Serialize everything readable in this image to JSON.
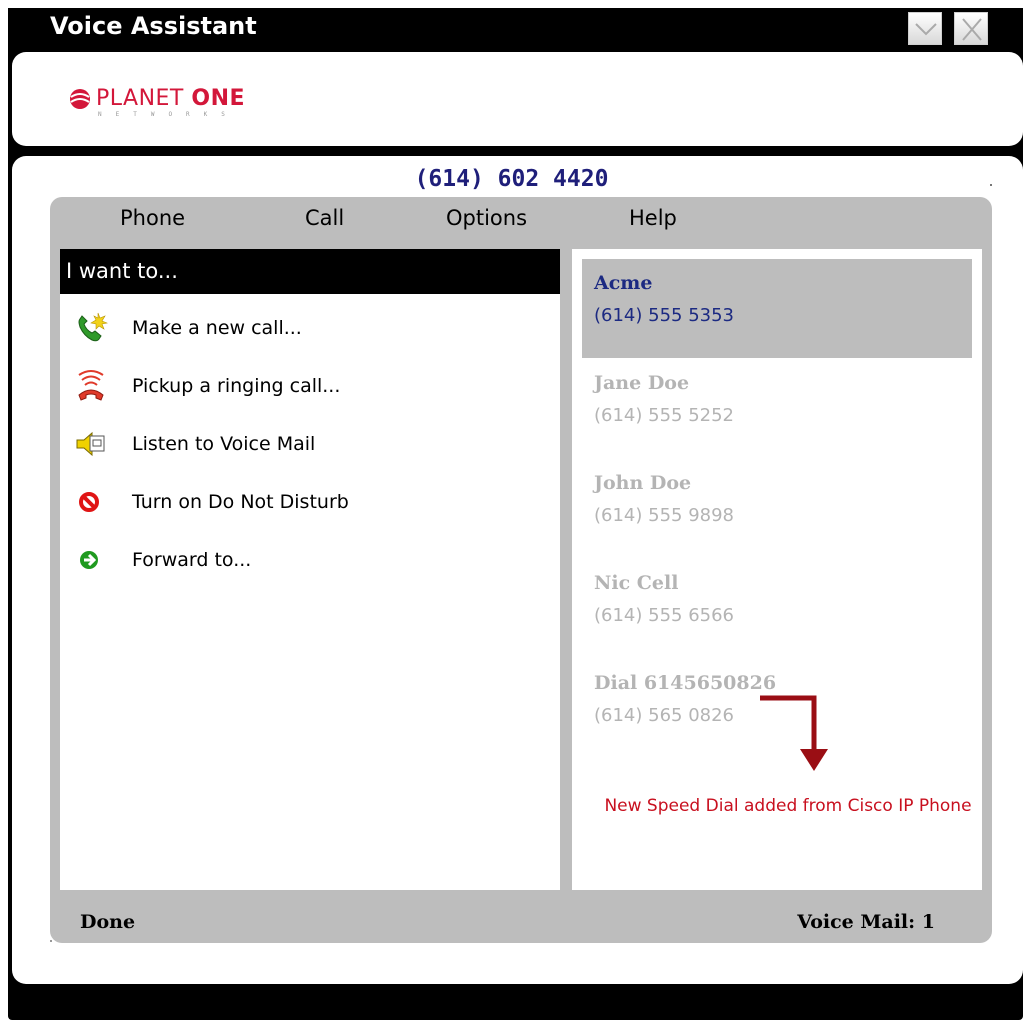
{
  "window": {
    "title": "Voice Assistant",
    "minimize_icon": "chevron-down-icon",
    "close_icon": "close-icon"
  },
  "logo": {
    "text_light": "PLANET",
    "text_bold": "ONE",
    "subtext": "NETWORKS",
    "brand_color": "#d3173a"
  },
  "header": {
    "phone_number": "(614) 602 4420"
  },
  "menu": {
    "items": [
      "Phone",
      "Call",
      "Options",
      "Help"
    ]
  },
  "actions": {
    "header": "I want to...",
    "items": [
      {
        "label": "Make a new call...",
        "icon": "new-call-phone-icon"
      },
      {
        "label": "Pickup a ringing call...",
        "icon": "ringing-phone-icon"
      },
      {
        "label": "Listen to Voice Mail",
        "icon": "voicemail-speaker-icon"
      },
      {
        "label": "Turn on Do Not Disturb",
        "icon": "do-not-disturb-icon"
      },
      {
        "label": "Forward to...",
        "icon": "forward-arrow-icon"
      }
    ]
  },
  "speed_dials": {
    "items": [
      {
        "name": "Acme",
        "number": "(614) 555 5353",
        "selected": true
      },
      {
        "name": "Jane Doe",
        "number": "(614) 555 5252",
        "selected": false
      },
      {
        "name": "John Doe",
        "number": "(614) 555 9898",
        "selected": false
      },
      {
        "name": "Nic Cell",
        "number": "(614) 555 6566",
        "selected": false
      },
      {
        "name": "Dial 6145650826",
        "number": "(614) 565 0826",
        "selected": false
      }
    ],
    "annotation": "New Speed Dial added from Cisco IP Phone",
    "annotation_color": "#c8101f"
  },
  "status": {
    "left": "Done",
    "right": "Voice Mail: 1"
  }
}
